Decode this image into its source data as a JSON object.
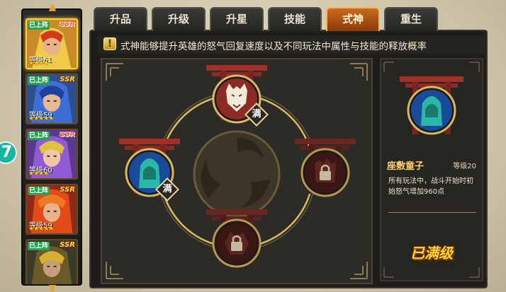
{
  "tabs": [
    {
      "label": "升品",
      "active": false
    },
    {
      "label": "升级",
      "active": false
    },
    {
      "label": "升星",
      "active": false
    },
    {
      "label": "技能",
      "active": false
    },
    {
      "label": "式神",
      "active": true
    },
    {
      "label": "重生",
      "active": false
    }
  ],
  "info": {
    "icon": "exclamation-icon",
    "text": "式神能够提升英雄的怒气回复速度以及不同玩法中属性与技能的释放概率"
  },
  "side_badge": "7",
  "hero_list": [
    {
      "tag": "已上阵",
      "rarity": "SSR",
      "level": "等级61",
      "stars": "★★★★",
      "selected": true,
      "theme": "gold"
    },
    {
      "tag": "已上阵",
      "rarity": "SSR",
      "level": "等级59",
      "stars": "★★★★★",
      "selected": false,
      "theme": "blue"
    },
    {
      "tag": "已上阵",
      "rarity": "SSR",
      "level": "等级60",
      "stars": "★★★★",
      "selected": false,
      "theme": "purple"
    },
    {
      "tag": "已上阵",
      "rarity": "SSR",
      "level": "等级59",
      "stars": "★★★★★",
      "selected": false,
      "theme": "red"
    },
    {
      "tag": "已上阵",
      "rarity": "SSR",
      "level": "",
      "stars": "",
      "selected": false,
      "theme": "dark"
    }
  ],
  "shikigami_slots": [
    {
      "name": "wolf-shikigami",
      "state": "maxed",
      "badge": "满"
    },
    {
      "name": "hooded-shikigami",
      "state": "maxed",
      "badge": "满"
    },
    {
      "name": "locked-slot-right",
      "state": "locked",
      "badge": ""
    },
    {
      "name": "locked-slot-bottom",
      "state": "locked",
      "badge": ""
    }
  ],
  "detail": {
    "name": "座敷童子",
    "level": "等级20",
    "description": "所有玩法中，战斗开始时初始怒气增加960点",
    "status": "已满级"
  },
  "colors": {
    "active_tab": "#c96a1f",
    "accent_gold": "#ffd23a",
    "teal": "#2ab8a6",
    "torii_red": "#8e2a26"
  }
}
